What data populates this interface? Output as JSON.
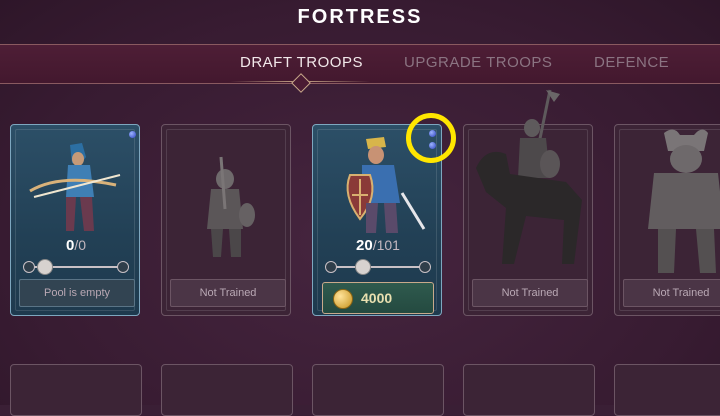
{
  "header": {
    "title": "FORTRESS"
  },
  "tabs": [
    {
      "label": "DRAFT TROOPS",
      "active": true
    },
    {
      "label": "UPGRADE TROOPS",
      "active": false
    },
    {
      "label": "DEFENCE",
      "active": false
    }
  ],
  "troops": [
    {
      "name": "archer",
      "state": "trained",
      "count": "0",
      "max": "/0",
      "status": "Pool is empty",
      "slider_fraction": 0.0
    },
    {
      "name": "peasant",
      "state": "not-trained",
      "status": "Not Trained"
    },
    {
      "name": "swordsman",
      "state": "trained",
      "count": "20",
      "max": "/101",
      "cost": "4000",
      "slider_fraction": 0.2,
      "gems": 2
    },
    {
      "name": "dark-knight",
      "state": "not-trained",
      "status": "Not Trained"
    },
    {
      "name": "minotaur",
      "state": "not-trained",
      "status": "Not Trained"
    }
  ],
  "colors": {
    "background": "#3a1f35",
    "highlight": "#ffe600",
    "trained_card": "#224055",
    "gem": "#2b3fbf"
  },
  "icons": [
    "gem-icon",
    "coin-icon",
    "chevron-left-icon",
    "chevron-right-icon"
  ]
}
